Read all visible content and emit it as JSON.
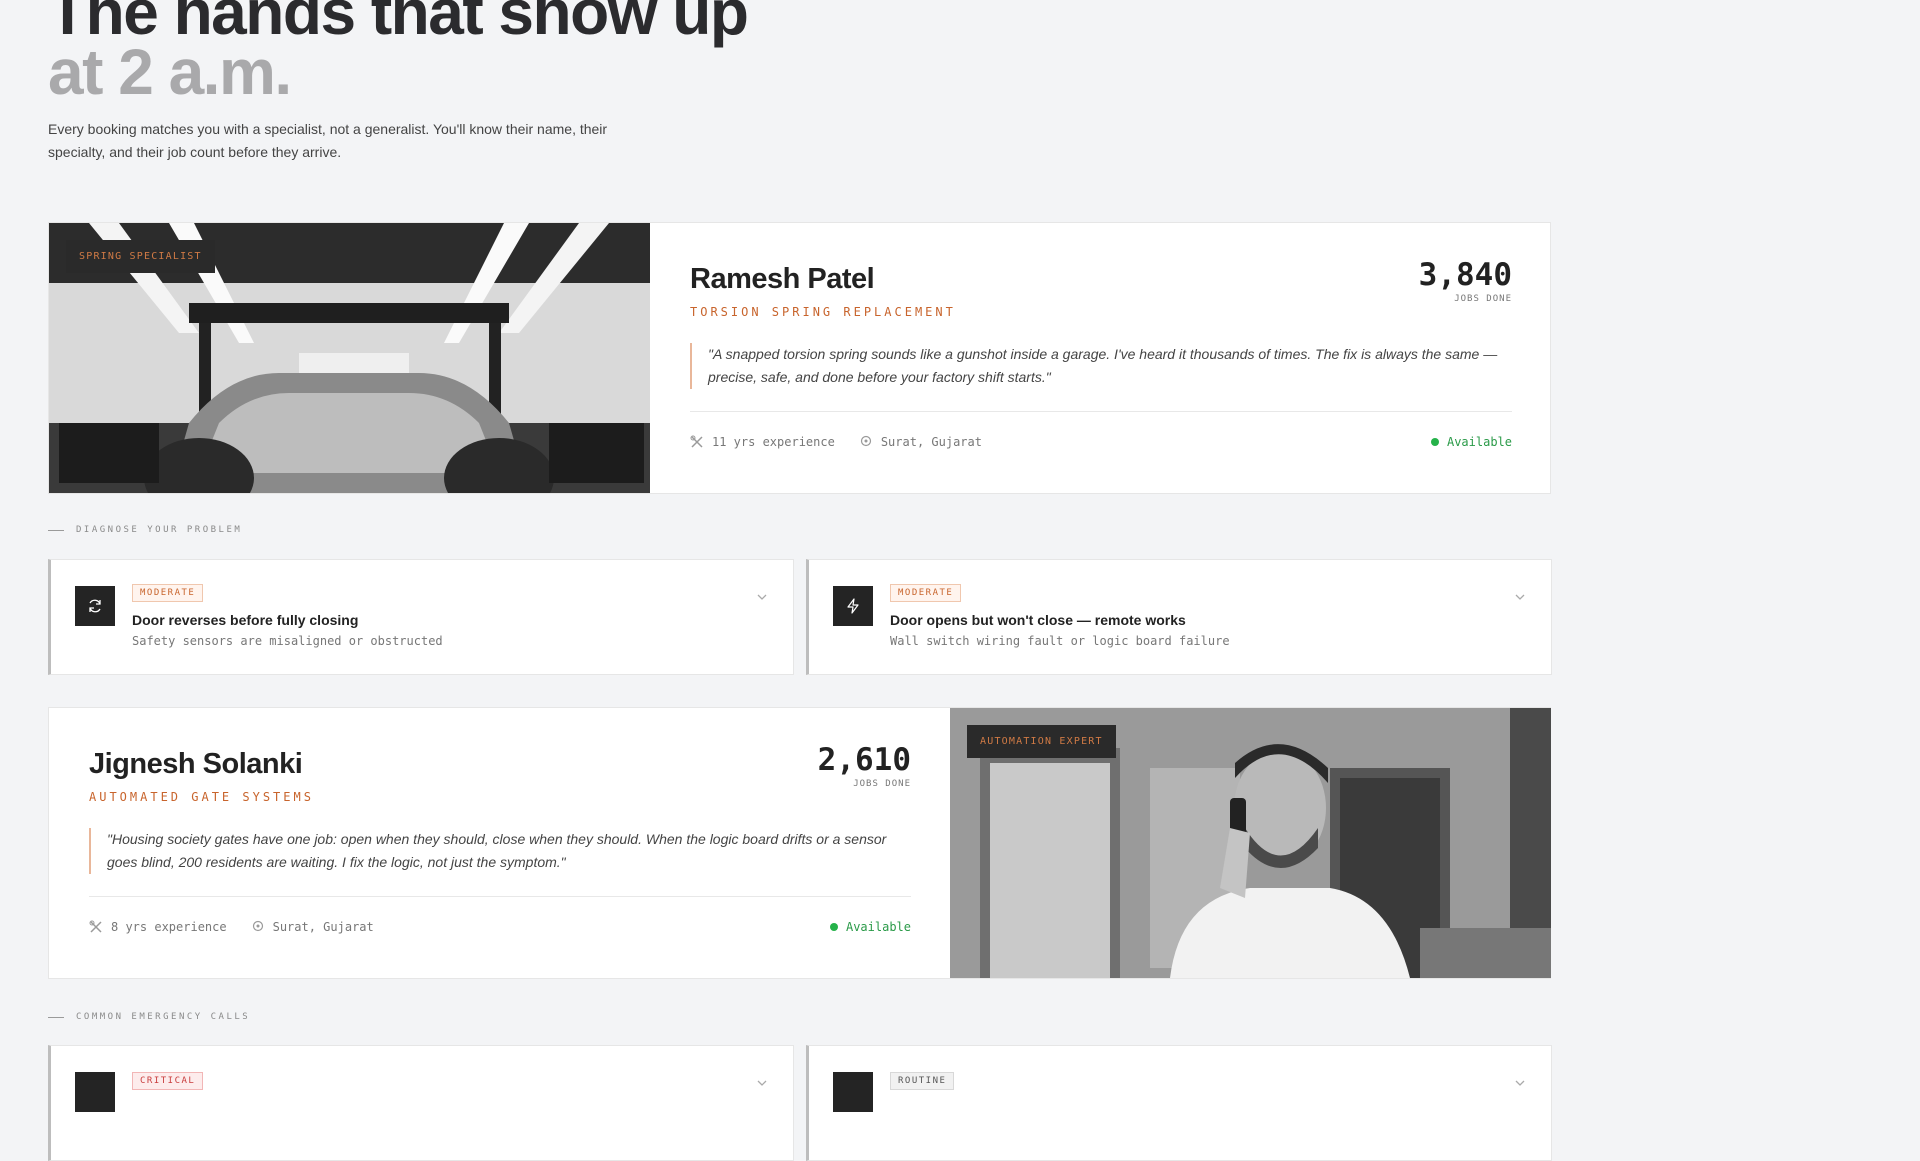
{
  "hero": {
    "title_line1": "The hands that show up",
    "title_line2": "at 2 a.m.",
    "subtitle": "Every booking matches you with a specialist, not a generalist. You'll know their name, their specialty, and their job count before they arrive."
  },
  "specialists": [
    {
      "tag": "SPRING SPECIALIST",
      "name": "Ramesh Patel",
      "role": "TORSION SPRING REPLACEMENT",
      "jobs_count": "3,840",
      "jobs_label": "JOBS DONE",
      "quote": "\"A snapped torsion spring sounds like a gunshot inside a garage. I've heard it thousands of times. The fix is always the same — precise, safe, and done before your factory shift starts.\"",
      "experience": "11 yrs experience",
      "location": "Surat, Gujarat",
      "status": "Available",
      "photo_icon": "garage-car-photo"
    },
    {
      "tag": "AUTOMATION EXPERT",
      "name": "Jignesh Solanki",
      "role": "AUTOMATED GATE SYSTEMS",
      "jobs_count": "2,610",
      "jobs_label": "JOBS DONE",
      "quote": "\"Housing society gates have one job: open when they should, close when they should. When the logic board drifts or a sensor goes blind, 200 residents are waiting. I fix the logic, not just the symptom.\"",
      "experience": "8 yrs experience",
      "location": "Surat, Gujarat",
      "status": "Available",
      "photo_icon": "man-on-phone-photo"
    }
  ],
  "sections": {
    "diagnose": "DIAGNOSE YOUR PROBLEM",
    "emergency": "COMMON EMERGENCY CALLS"
  },
  "problems": [
    {
      "severity": "MODERATE",
      "title": "Door reverses before fully closing",
      "desc": "Safety sensors are misaligned or obstructed",
      "icon": "refresh-icon"
    },
    {
      "severity": "MODERATE",
      "title": "Door opens but won't close — remote works",
      "desc": "Wall switch wiring fault or logic board failure",
      "icon": "lightning-icon"
    }
  ],
  "emergency": [
    {
      "severity": "CRITICAL"
    },
    {
      "severity": "ROUTINE"
    }
  ],
  "colors": {
    "accent": "#c8642c",
    "available": "#25b24a",
    "ink": "#2b2b2e",
    "muted": "#a9a9ab"
  }
}
